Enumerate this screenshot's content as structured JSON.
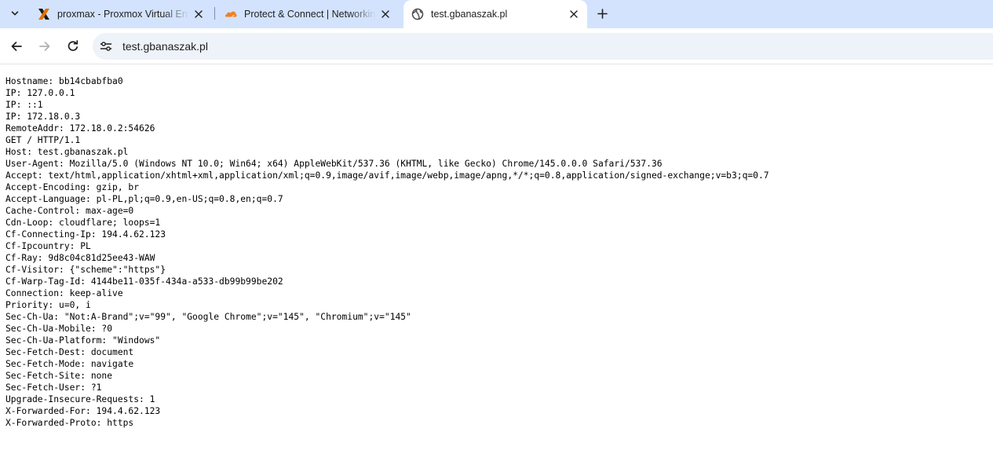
{
  "browser": {
    "tabs": [
      {
        "title": "proxmax - Proxmox Virtual Environment",
        "favicon": "proxmox-icon",
        "active": false
      },
      {
        "title": "Protect & Connect | Networking",
        "favicon": "cloudflare-icon",
        "active": false
      },
      {
        "title": "test.gbanaszak.pl",
        "favicon": "globe-icon",
        "active": true
      }
    ],
    "address_bar": {
      "url": "test.gbanaszak.pl"
    },
    "colors": {
      "tabstrip": "#d3e3fd",
      "omnibox": "#eef2f9",
      "proxmox_orange": "#e57000",
      "cloudflare_orange": "#f38020"
    }
  },
  "page": {
    "lines": [
      "Hostname: bb14cbabfba0",
      "IP: 127.0.0.1",
      "IP: ::1",
      "IP: 172.18.0.3",
      "RemoteAddr: 172.18.0.2:54626",
      "GET / HTTP/1.1",
      "Host: test.gbanaszak.pl",
      "User-Agent: Mozilla/5.0 (Windows NT 10.0; Win64; x64) AppleWebKit/537.36 (KHTML, like Gecko) Chrome/145.0.0.0 Safari/537.36",
      "Accept: text/html,application/xhtml+xml,application/xml;q=0.9,image/avif,image/webp,image/apng,*/*;q=0.8,application/signed-exchange;v=b3;q=0.7",
      "Accept-Encoding: gzip, br",
      "Accept-Language: pl-PL,pl;q=0.9,en-US;q=0.8,en;q=0.7",
      "Cache-Control: max-age=0",
      "Cdn-Loop: cloudflare; loops=1",
      "Cf-Connecting-Ip: 194.4.62.123",
      "Cf-Ipcountry: PL",
      "Cf-Ray: 9d8c04c81d25ee43-WAW",
      "Cf-Visitor: {\"scheme\":\"https\"}",
      "Cf-Warp-Tag-Id: 4144be11-035f-434a-a533-db99b99be202",
      "Connection: keep-alive",
      "Priority: u=0, i",
      "Sec-Ch-Ua: \"Not:A-Brand\";v=\"99\", \"Google Chrome\";v=\"145\", \"Chromium\";v=\"145\"",
      "Sec-Ch-Ua-Mobile: ?0",
      "Sec-Ch-Ua-Platform: \"Windows\"",
      "Sec-Fetch-Dest: document",
      "Sec-Fetch-Mode: navigate",
      "Sec-Fetch-Site: none",
      "Sec-Fetch-User: ?1",
      "Upgrade-Insecure-Requests: 1",
      "X-Forwarded-For: 194.4.62.123",
      "X-Forwarded-Proto: https"
    ]
  }
}
